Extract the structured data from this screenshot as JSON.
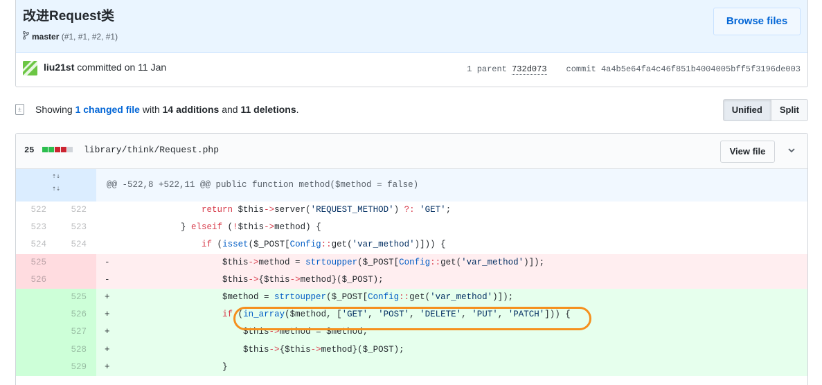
{
  "commit": {
    "title": "改进Request类",
    "branch": "master",
    "branch_refs": "(#1, #1, #2, #1)",
    "browse_label": "Browse files",
    "author": "liu21st",
    "committed_text": "committed on 11 Jan",
    "parent_label": "1 parent",
    "parent_sha": "732d073",
    "commit_label": "commit",
    "commit_sha": "4a4b5e64fa4c46f851b4004005bff5f3196de003"
  },
  "summary": {
    "showing": "Showing",
    "changed": "1 changed file",
    "with": "with",
    "additions": "14 additions",
    "and": "and",
    "deletions": "11 deletions",
    "period": ".",
    "unified_label": "Unified",
    "split_label": "Split"
  },
  "file": {
    "changes": "25",
    "path": "library/think/Request.php",
    "view_file_label": "View file",
    "diffstat_colors": [
      "#2cbe4e",
      "#2cbe4e",
      "#cb2431",
      "#cb2431",
      "#d1d5da"
    ]
  },
  "diff": {
    "hunk_header": "@@ -522,8 +522,11 @@ public function method($method = false)",
    "lines": [
      {
        "type": "ctx",
        "old": "522",
        "new": "522",
        "sign": "",
        "code": "                return $this->server('REQUEST_METHOD') ?: 'GET';"
      },
      {
        "type": "ctx",
        "old": "523",
        "new": "523",
        "sign": "",
        "code": "            } elseif (!$this->method) {"
      },
      {
        "type": "ctx",
        "old": "524",
        "new": "524",
        "sign": "",
        "code": "                if (isset($_POST[Config::get('var_method')])) {"
      },
      {
        "type": "del",
        "old": "525",
        "new": "",
        "sign": "-",
        "code": "                    $this->method = strtoupper($_POST[Config::get('var_method')]);"
      },
      {
        "type": "del",
        "old": "526",
        "new": "",
        "sign": "-",
        "code": "                    $this->{$this->method}($_POST);"
      },
      {
        "type": "add",
        "old": "",
        "new": "525",
        "sign": "+",
        "code": "                    $method = strtoupper($_POST[Config::get('var_method')]);"
      },
      {
        "type": "add",
        "old": "",
        "new": "526",
        "sign": "+",
        "code": "                    if (in_array($method, ['GET', 'POST', 'DELETE', 'PUT', 'PATCH'])) {"
      },
      {
        "type": "add",
        "old": "",
        "new": "527",
        "sign": "+",
        "code": "                        $this->method = $method;"
      },
      {
        "type": "add",
        "old": "",
        "new": "528",
        "sign": "+",
        "code": "                        $this->{$this->method}($_POST);"
      },
      {
        "type": "add",
        "old": "",
        "new": "529",
        "sign": "+",
        "code": "                    }"
      }
    ]
  },
  "annotation": {
    "color": "#f5901e"
  }
}
